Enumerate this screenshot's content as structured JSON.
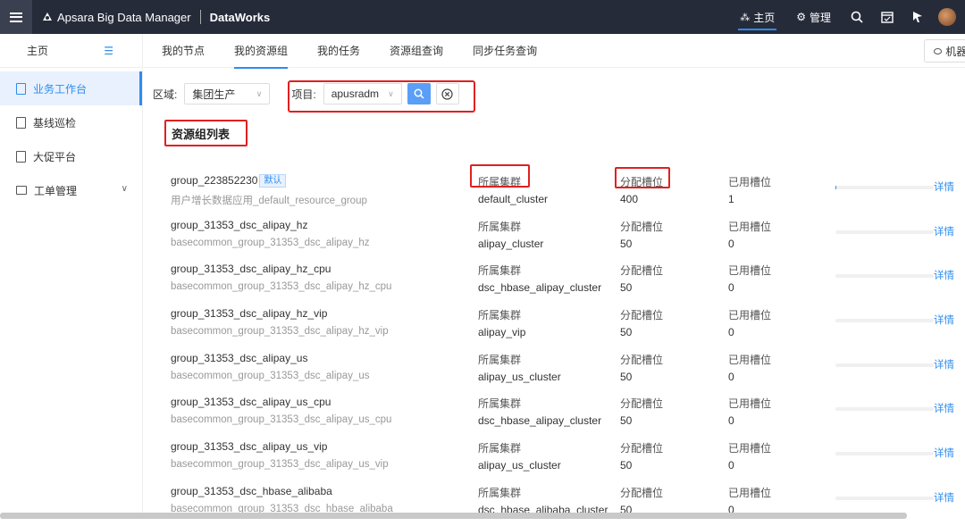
{
  "topbar": {
    "brand": "Apsara Big Data Manager",
    "product": "DataWorks",
    "home_label": "主页",
    "manage_label": "管理"
  },
  "sidebar": {
    "header": "主页",
    "items": [
      {
        "label": "业务工作台",
        "active": true
      },
      {
        "label": "基线巡检",
        "active": false
      },
      {
        "label": "大促平台",
        "active": false
      },
      {
        "label": "工单管理",
        "active": false
      }
    ]
  },
  "tabs": [
    {
      "label": "我的节点",
      "active": false
    },
    {
      "label": "我的资源组",
      "active": true
    },
    {
      "label": "我的任务",
      "active": false
    },
    {
      "label": "资源组查询",
      "active": false
    },
    {
      "label": "同步任务查询",
      "active": false
    }
  ],
  "robot_button": "机器",
  "filters": {
    "region_label": "区域:",
    "region_value": "集团生产",
    "project_label": "项目:",
    "project_value": "apusradm"
  },
  "list_title": "资源组列表",
  "labels": {
    "cluster": "所属集群",
    "allocated": "分配槽位",
    "used": "已用槽位",
    "detail": "详情",
    "default_badge": "默认"
  },
  "groups": [
    {
      "name": "group_223852230",
      "desc": "用户增长数据应用_default_resource_group",
      "cluster": "default_cluster",
      "allocated": "400",
      "used": "1",
      "usage": 0.0025,
      "default": true
    },
    {
      "name": "group_31353_dsc_alipay_hz",
      "desc": "basecommon_group_31353_dsc_alipay_hz",
      "cluster": "alipay_cluster",
      "allocated": "50",
      "used": "0",
      "usage": 0,
      "default": false
    },
    {
      "name": "group_31353_dsc_alipay_hz_cpu",
      "desc": "basecommon_group_31353_dsc_alipay_hz_cpu",
      "cluster": "dsc_hbase_alipay_cluster",
      "allocated": "50",
      "used": "0",
      "usage": 0,
      "default": false
    },
    {
      "name": "group_31353_dsc_alipay_hz_vip",
      "desc": "basecommon_group_31353_dsc_alipay_hz_vip",
      "cluster": "alipay_vip",
      "allocated": "50",
      "used": "0",
      "usage": 0,
      "default": false
    },
    {
      "name": "group_31353_dsc_alipay_us",
      "desc": "basecommon_group_31353_dsc_alipay_us",
      "cluster": "alipay_us_cluster",
      "allocated": "50",
      "used": "0",
      "usage": 0,
      "default": false
    },
    {
      "name": "group_31353_dsc_alipay_us_cpu",
      "desc": "basecommon_group_31353_dsc_alipay_us_cpu",
      "cluster": "dsc_hbase_alipay_cluster",
      "allocated": "50",
      "used": "0",
      "usage": 0,
      "default": false
    },
    {
      "name": "group_31353_dsc_alipay_us_vip",
      "desc": "basecommon_group_31353_dsc_alipay_us_vip",
      "cluster": "alipay_us_cluster",
      "allocated": "50",
      "used": "0",
      "usage": 0,
      "default": false
    },
    {
      "name": "group_31353_dsc_hbase_alibaba",
      "desc": "basecommon_group_31353_dsc_hbase_alibaba",
      "cluster": "dsc_hbase_alibaba_cluster",
      "allocated": "50",
      "used": "0",
      "usage": 0,
      "default": false
    }
  ]
}
